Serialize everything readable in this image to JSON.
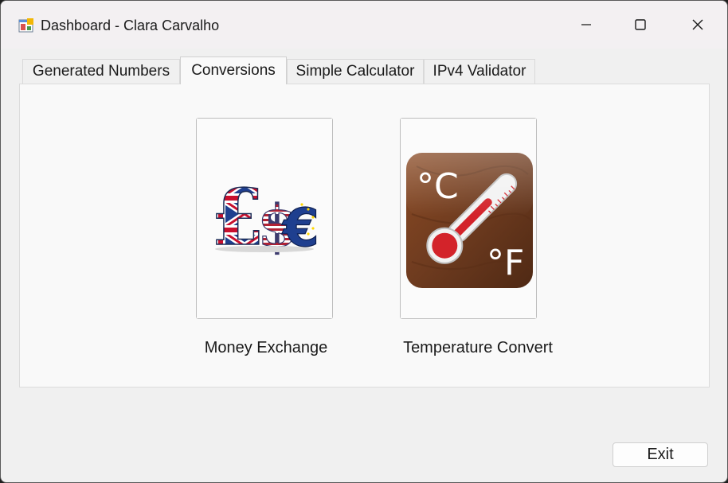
{
  "window": {
    "title": "Dashboard - Clara Carvalho",
    "app_icon": "form-icon",
    "controls": {
      "minimize_icon": "minimize-icon",
      "maximize_icon": "maximize-icon",
      "close_icon": "close-icon"
    }
  },
  "tabs": [
    {
      "label": "Generated Numbers",
      "active": false
    },
    {
      "label": "Conversions",
      "active": true
    },
    {
      "label": "Simple Calculator",
      "active": false
    },
    {
      "label": "IPv4 Validator",
      "active": false
    }
  ],
  "conversions": {
    "money": {
      "label": "Money Exchange",
      "icon": "currency-symbols-icon"
    },
    "temperature": {
      "label": "Temperature Convert",
      "icon": "thermometer-icon",
      "unit_c": "°C",
      "unit_f": "°F"
    }
  },
  "footer": {
    "exit_label": "Exit"
  },
  "colors": {
    "window_bg": "#f0f0f0",
    "panel_bg": "#f9f9f9",
    "thermo_red": "#d3232a",
    "wood_brown": "#6e3b1f"
  }
}
